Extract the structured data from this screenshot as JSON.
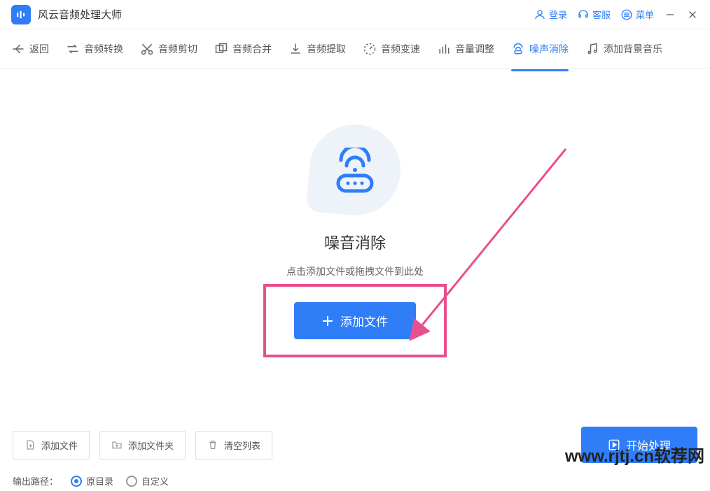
{
  "app": {
    "title": "风云音频处理大师"
  },
  "titlebar": {
    "login": "登录",
    "support": "客服",
    "menu": "菜单"
  },
  "toolbar": {
    "back": "返回",
    "items": [
      {
        "label": "音频转换"
      },
      {
        "label": "音频剪切"
      },
      {
        "label": "音频合并"
      },
      {
        "label": "音频提取"
      },
      {
        "label": "音频变速"
      },
      {
        "label": "音量调整"
      },
      {
        "label": "噪声消除"
      },
      {
        "label": "添加背景音乐"
      }
    ]
  },
  "main": {
    "title": "噪音消除",
    "subtitle": "点击添加文件或拖拽文件到此处",
    "add_button": "添加文件"
  },
  "bottom": {
    "add_file": "添加文件",
    "add_folder": "添加文件夹",
    "clear_list": "清空列表",
    "start": "开始处理",
    "output_label": "输出路径：",
    "radio_original": "原目录",
    "radio_custom": "自定义"
  },
  "watermark": "www.rjtj.cn软荐网"
}
